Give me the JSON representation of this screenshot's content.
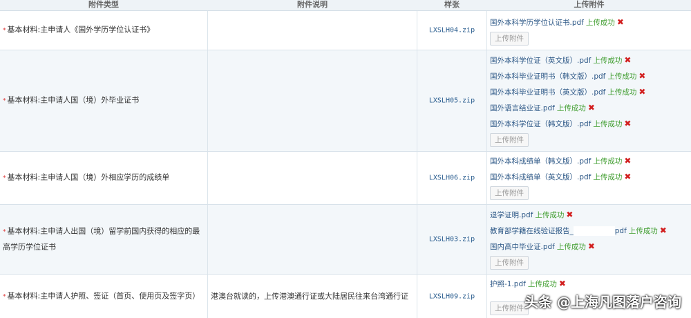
{
  "header": {
    "col_type": "附件类型",
    "col_desc": "附件说明",
    "col_sample": "样张",
    "col_upload": "上传附件"
  },
  "required_mark": "*",
  "status_text": "上传成功",
  "delete_glyph": "✖",
  "upload_button_label": "上传附件",
  "rows": [
    {
      "type": "基本材料:主申请人《国外学历学位认证书》",
      "desc": "",
      "sample": "LXSLH04.zip",
      "files": [
        "国外本科学历学位认证书.pdf"
      ]
    },
    {
      "type": "基本材料:主申请人国（境）外毕业证书",
      "desc": "",
      "sample": "LXSLH05.zip",
      "files": [
        "国外本科学位证（英文版）.pdf",
        "国外本科毕业证明书（韩文版）.pdf",
        "国外本科毕业证明书（英文版）.pdf",
        "国外语言结业证.pdf",
        "国外本科学位证（韩文版）.pdf"
      ]
    },
    {
      "type": "基本材料:主申请人国（境）外相应学历的成绩单",
      "desc": "",
      "sample": "LXSLH06.zip",
      "files": [
        "国外本科成绩单（韩文版）.pdf",
        "国外本科成绩单（英文版）.pdf"
      ]
    },
    {
      "type": "基本材料:主申请人出国（境）留学前国内获得的相应的最高学历学位证书",
      "desc": "",
      "sample": "LXSLH03.zip",
      "files": [
        "退学证明.pdf",
        "教育部学籍在线验证报告_",
        "国内高中毕业证.pdf"
      ]
    },
    {
      "type": "基本材料:主申请人护照、签证（首页、使用页及签字页）",
      "desc": "港澳台就读的，上传港澳通行证或大陆居民往来台湾通行证",
      "sample": "LXSLH09.zip",
      "files": [
        "护照-1.pdf"
      ]
    }
  ],
  "redacted_suffix": "pdf",
  "watermark": "头条 @上海凡图落户咨询",
  "icons": {
    "delete": "close-x-icon"
  }
}
